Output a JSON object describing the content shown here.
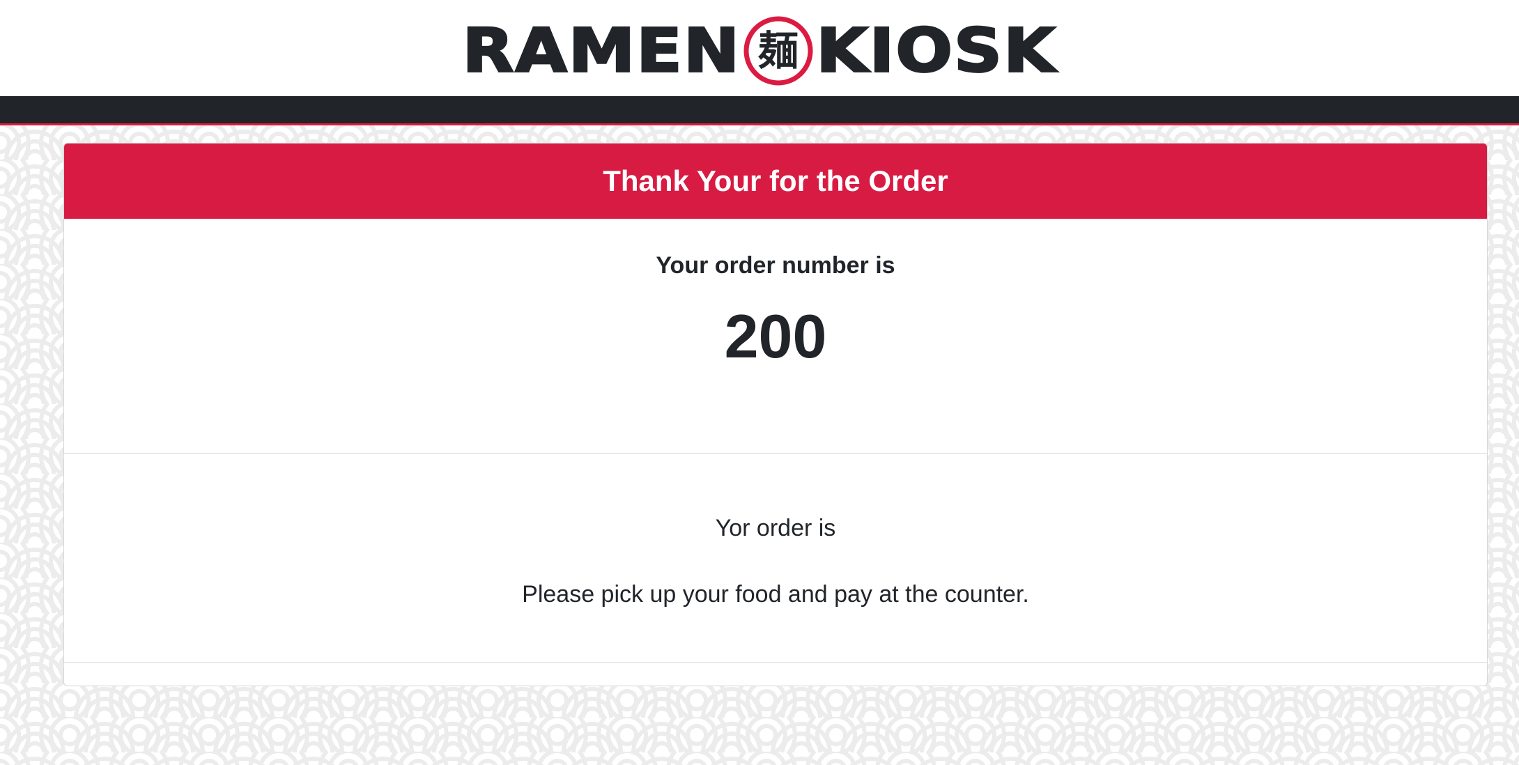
{
  "header": {
    "logo_left": "RAMEN",
    "logo_seal_char": "麺",
    "logo_right": "KIOSK"
  },
  "colors": {
    "accent": "#d81b43",
    "navbar": "#212529",
    "text": "#212529"
  },
  "card": {
    "title": "Thank Your for the Order",
    "order_label": "Your order number is",
    "order_number": "200",
    "order_summary": "Yor order is",
    "instructions": "Please pick up your food and pay at the counter."
  },
  "icons": {
    "logo_seal": "noodle-seal-icon"
  }
}
